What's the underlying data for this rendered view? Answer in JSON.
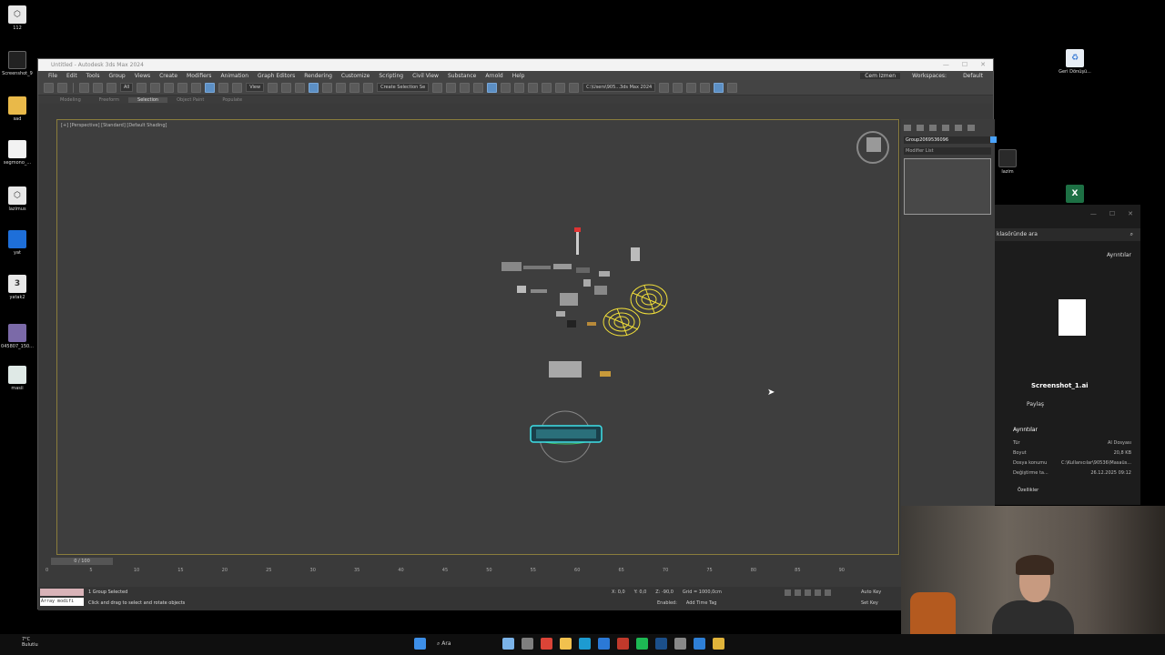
{
  "desktop": {
    "icons_left": [
      {
        "label": "112",
        "color": "#e8e8e8",
        "glyph": "⬡"
      },
      {
        "label": "Screenshot_9",
        "color": "#222",
        "glyph": ""
      },
      {
        "label": "sad",
        "color": "#e9b949",
        "glyph": ""
      },
      {
        "label": "segmono_...",
        "color": "#f2f2f2",
        "glyph": ""
      },
      {
        "label": "lazimus",
        "color": "#e8e8e8",
        "glyph": "⬡"
      },
      {
        "label": "yat",
        "color": "#1e6fd9",
        "glyph": ""
      },
      {
        "label": "yatak2",
        "color": "#e8e8e8",
        "glyph": "3"
      },
      {
        "label": "045807_150...",
        "color": "#7b6aa8",
        "glyph": ""
      },
      {
        "label": "masii",
        "color": "#dfe9e6",
        "glyph": ""
      }
    ],
    "icons_right": [
      {
        "label": "Geri Dönüşü...",
        "color": "#e8eef5",
        "glyph": "♻"
      },
      {
        "label": "lazim",
        "color": "#2a2a2a",
        "glyph": ""
      },
      {
        "label": "",
        "color": "#1d7044",
        "glyph": "X"
      }
    ]
  },
  "max": {
    "title": "Untitled - Autodesk 3ds Max 2024",
    "menu": [
      "File",
      "Edit",
      "Tools",
      "Group",
      "Views",
      "Create",
      "Modifiers",
      "Animation",
      "Graph Editors",
      "Rendering",
      "Customize",
      "Scripting",
      "Civil View",
      "Substance",
      "Arnold",
      "Help"
    ],
    "sign_in": "Cem Izmen",
    "workspaces_label": "Workspaces:",
    "workspaces_value": "Default",
    "toolbar": {
      "filter": "All",
      "ref_coord": "View",
      "selection_set": "Create Selection Se",
      "path": "C:\\Users\\905...3ds Max 2024"
    },
    "ribbon_tabs": [
      "Modeling",
      "Freeform",
      "Selection",
      "Object Paint",
      "Populate"
    ],
    "ribbon_active": "Selection",
    "viewport_label": "[+] [Perspective] [Standard] [Default Shading]",
    "command_panel": {
      "object_name": "Group2069536096",
      "modifier_list": "Modifier List"
    },
    "timeline": {
      "slider": "0 / 100",
      "ticks": [
        "0",
        "5",
        "10",
        "15",
        "20",
        "25",
        "30",
        "35",
        "40",
        "45",
        "50",
        "55",
        "60",
        "65",
        "70",
        "75",
        "80",
        "85",
        "90"
      ]
    },
    "status": {
      "maxscript": "Array modifi",
      "selected": "1 Group Selected",
      "prompt": "Click and drag to select and rotate objects",
      "x": "X: 0,0",
      "y": "Y: 0,0",
      "z": "Z: -90,0",
      "grid": "Grid = 1000,0cm",
      "enabled": "Enabled:",
      "add_time_tag": "Add Time Tag",
      "auto_key": "Auto Key",
      "set_key": "Set Key",
      "selected_dd": "Selecte"
    }
  },
  "explorer": {
    "search": "klasöründe ara",
    "details_button": "Ayrıntılar",
    "file_name": "Screenshot_1.ai",
    "share": "Paylaş",
    "details_header": "Ayrıntılar",
    "rows": [
      {
        "label": "Tür",
        "value": "AI Dosyası"
      },
      {
        "label": "Boyut",
        "value": "20,8 KB"
      },
      {
        "label": "Dosya konumu",
        "value": "C:\\Kullanıcılar\\90536\\Masaüs..."
      },
      {
        "label": "Değiştirme ta...",
        "value": "26.12.2025 09:12"
      }
    ],
    "properties": "Özellikler"
  },
  "taskbar": {
    "weather_temp": "7°C",
    "weather_desc": "Bulutlu",
    "search": "Ara",
    "apps": [
      {
        "name": "start",
        "color": "#3d8fe8"
      },
      {
        "name": "cloud",
        "color": "#7bb3e8"
      },
      {
        "name": "files",
        "color": "#7f7f7f"
      },
      {
        "name": "chrome",
        "color": "#db4437"
      },
      {
        "name": "explorer",
        "color": "#f2c14e"
      },
      {
        "name": "edge",
        "color": "#1d9bd1"
      },
      {
        "name": "mail",
        "color": "#2b79d6"
      },
      {
        "name": "3dsmax",
        "color": "#c0392b"
      },
      {
        "name": "spotify",
        "color": "#1db954"
      },
      {
        "name": "steam",
        "color": "#1b4f8a"
      },
      {
        "name": "settings",
        "color": "#888888"
      },
      {
        "name": "app1",
        "color": "#2e7fd6"
      },
      {
        "name": "app2",
        "color": "#e0b33a"
      }
    ]
  }
}
